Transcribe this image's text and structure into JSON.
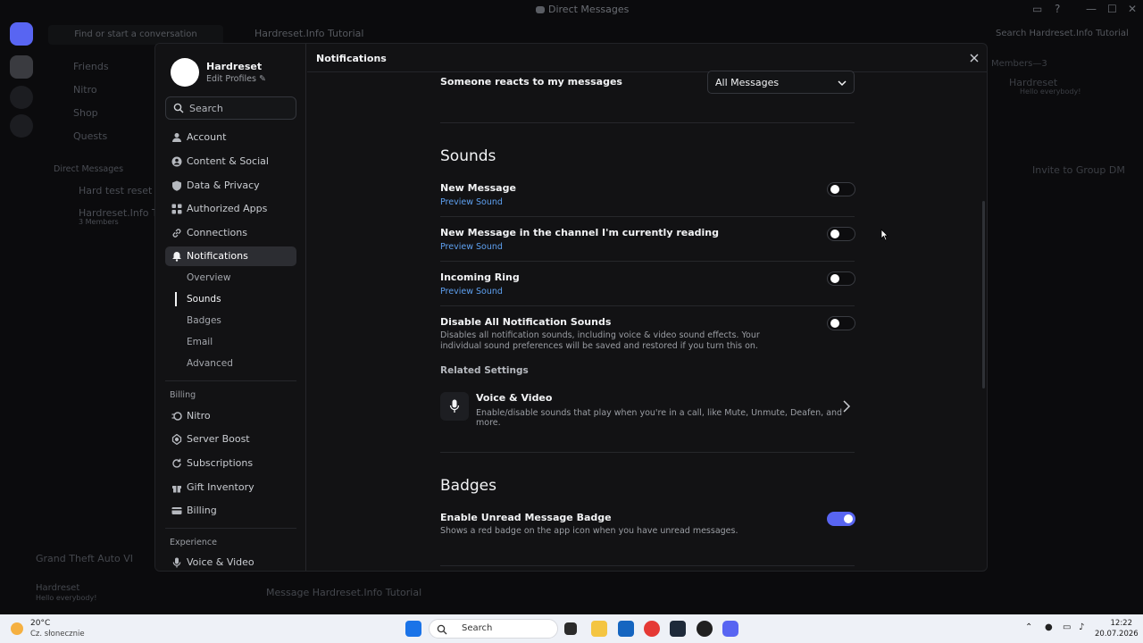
{
  "background": {
    "window_title": "Direct Messages",
    "find_placeholder": "Find or start a conversation",
    "channel_title": "Hardreset.Info Tutorial",
    "search_placeholder": "Search Hardreset.Info Tutorial",
    "dm_items": [
      "Friends",
      "Nitro",
      "Shop",
      "Quests"
    ],
    "dm_header": "Direct Messages",
    "dm_list": [
      "Hard test reset",
      "Hardreset.Info Tutor"
    ],
    "dm_sub": "3 Members",
    "members_header": "Members—3",
    "member_name": "Hardreset",
    "member_status": "Hello everybody!",
    "invite_label": "Invite to Group DM",
    "game_activity": "Grand Theft Auto VI",
    "user_name": "Hardreset",
    "user_status": "Hello everybody!",
    "message_placeholder": "Message Hardreset.Info Tutorial"
  },
  "profile": {
    "name": "Hardreset",
    "edit_label": "Edit Profiles"
  },
  "nav": {
    "search_placeholder": "Search",
    "items": [
      {
        "label": "Account"
      },
      {
        "label": "Content & Social"
      },
      {
        "label": "Data & Privacy"
      },
      {
        "label": "Authorized Apps"
      },
      {
        "label": "Connections"
      },
      {
        "label": "Notifications"
      }
    ],
    "sub_items": [
      "Overview",
      "Sounds",
      "Badges",
      "Email",
      "Advanced"
    ],
    "billing_heading": "Billing",
    "billing_items": [
      "Nitro",
      "Server Boost",
      "Subscriptions",
      "Gift Inventory",
      "Billing"
    ],
    "experience_heading": "Experience",
    "experience_items": [
      "Voice & Video"
    ]
  },
  "header": {
    "title": "Notifications"
  },
  "content": {
    "reacts_label": "Someone reacts to my messages",
    "reacts_value": "All Messages",
    "sounds_title": "Sounds",
    "sound_rows": [
      {
        "label": "New Message",
        "link": "Preview Sound",
        "on": false
      },
      {
        "label": "New Message in the channel I'm currently reading",
        "link": "Preview Sound",
        "on": false
      },
      {
        "label": "Incoming Ring",
        "link": "Preview Sound",
        "on": false
      }
    ],
    "disable_all": {
      "label": "Disable All Notification Sounds",
      "desc": "Disables all notification sounds, including voice & video sound effects. Your individual sound preferences will be saved and restored if you turn this on.",
      "on": false
    },
    "related_heading": "Related Settings",
    "related_title": "Voice & Video",
    "related_desc": "Enable/disable sounds that play when you're in a call, like Mute, Unmute, Deafen, and more.",
    "badges_title": "Badges",
    "unread_badge": {
      "label": "Enable Unread Message Badge",
      "desc": "Shows a red badge on the app icon when you have unread messages.",
      "on": true
    }
  },
  "taskbar": {
    "temperature": "20°C",
    "condition": "Cz. słonecznie",
    "search_placeholder": "Search",
    "time": "12:22",
    "date": "20.07.2026"
  },
  "colors": {
    "accent": "#5865f2",
    "link": "#5ea0f0"
  }
}
